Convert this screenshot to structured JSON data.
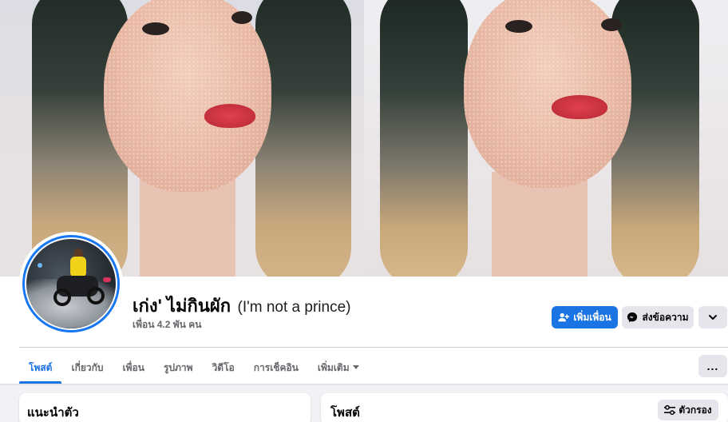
{
  "profile": {
    "name": "เก่ง' ไม่กินผัก",
    "alternate_name": "(I'm not a prince)",
    "friends_count": "เพื่อน 4.2 พัน คน"
  },
  "actions": {
    "add_friend_label": "เพิ่มเพื่อน",
    "message_label": "ส่งข้อความ",
    "add_friend_icon": "person-plus-icon",
    "message_icon": "messenger-icon",
    "dropdown_icon": "chevron-down-icon"
  },
  "tabs": [
    {
      "label": "โพสต์",
      "active": true
    },
    {
      "label": "เกี่ยวกับ",
      "active": false
    },
    {
      "label": "เพื่อน",
      "active": false
    },
    {
      "label": "รูปภาพ",
      "active": false
    },
    {
      "label": "วิดีโอ",
      "active": false
    },
    {
      "label": "การเช็คอิน",
      "active": false
    },
    {
      "label": "เพิ่มเติม",
      "active": false
    }
  ],
  "tabs_more_button": "...",
  "intro_card": {
    "title": "แนะนำตัว"
  },
  "posts_card": {
    "title": "โพสต์",
    "filter_label": "ตัวกรอง",
    "filter_icon": "sliders-icon"
  },
  "colors": {
    "brand_blue": "#1b74e4",
    "button_gray": "#e4e6eb",
    "page_bg": "#f0f2f5",
    "secondary_text": "#65676b"
  }
}
